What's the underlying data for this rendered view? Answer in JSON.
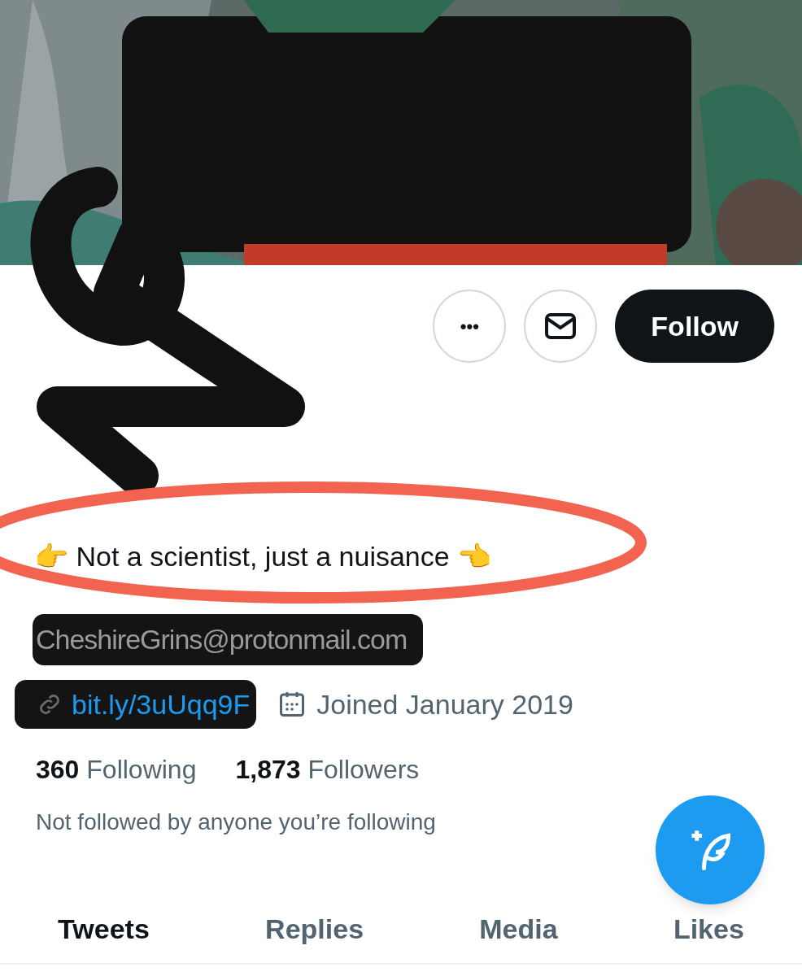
{
  "actions": {
    "more": "•••",
    "follow": "Follow"
  },
  "bio": "👉 Not a scientist, just a nuisance 👈",
  "email": "CheshireGrins@protonmail.com",
  "link": "bit.ly/3uUqq9F",
  "joined": "Joined January 2019",
  "stats": [
    {
      "count": "360",
      "label": "Following"
    },
    {
      "count": "1,873",
      "label": "Followers"
    }
  ],
  "followed_by": "Not followed by anyone you’re following",
  "tabs": [
    {
      "label": "Tweets",
      "selected": true
    },
    {
      "label": "Replies",
      "selected": false
    },
    {
      "label": "Media",
      "selected": false
    },
    {
      "label": "Likes",
      "selected": false
    }
  ]
}
